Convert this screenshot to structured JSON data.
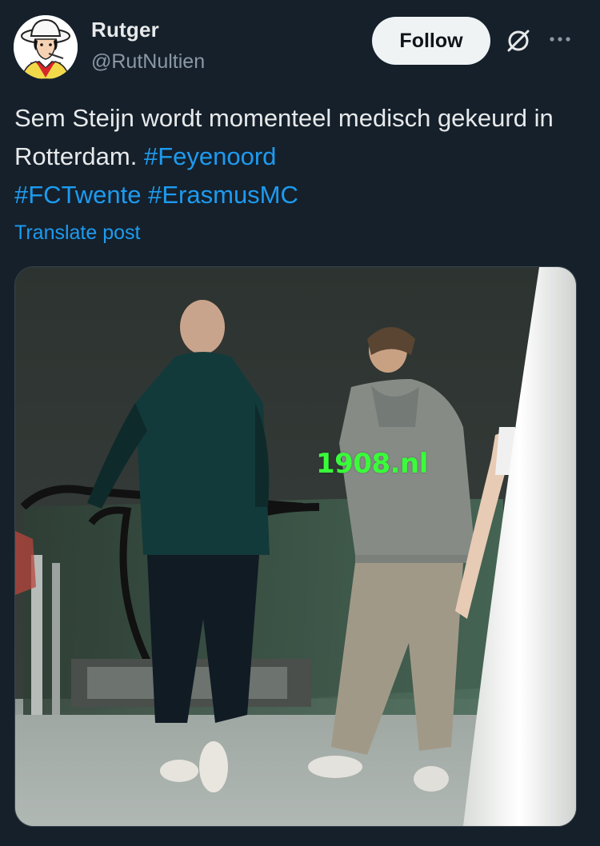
{
  "author": {
    "name": "Rutger",
    "handle": "@RutNultien"
  },
  "actions": {
    "follow_label": "Follow"
  },
  "post": {
    "text_plain": "Sem Steijn wordt momenteel medisch gekeurd in Rotterdam.",
    "hashtags": [
      "#Feyenoord",
      "#FCTwente",
      "#ErasmusMC"
    ],
    "translate_label": "Translate post"
  },
  "media": {
    "watermark": "1908.nl"
  },
  "colors": {
    "background": "#15202b",
    "text": "#e7e9ea",
    "secondary_text": "#8b98a5",
    "link": "#1d9bf0",
    "follow_button_bg": "#eff3f4"
  },
  "icons": {
    "grok": "grok-icon",
    "more": "more-icon"
  }
}
